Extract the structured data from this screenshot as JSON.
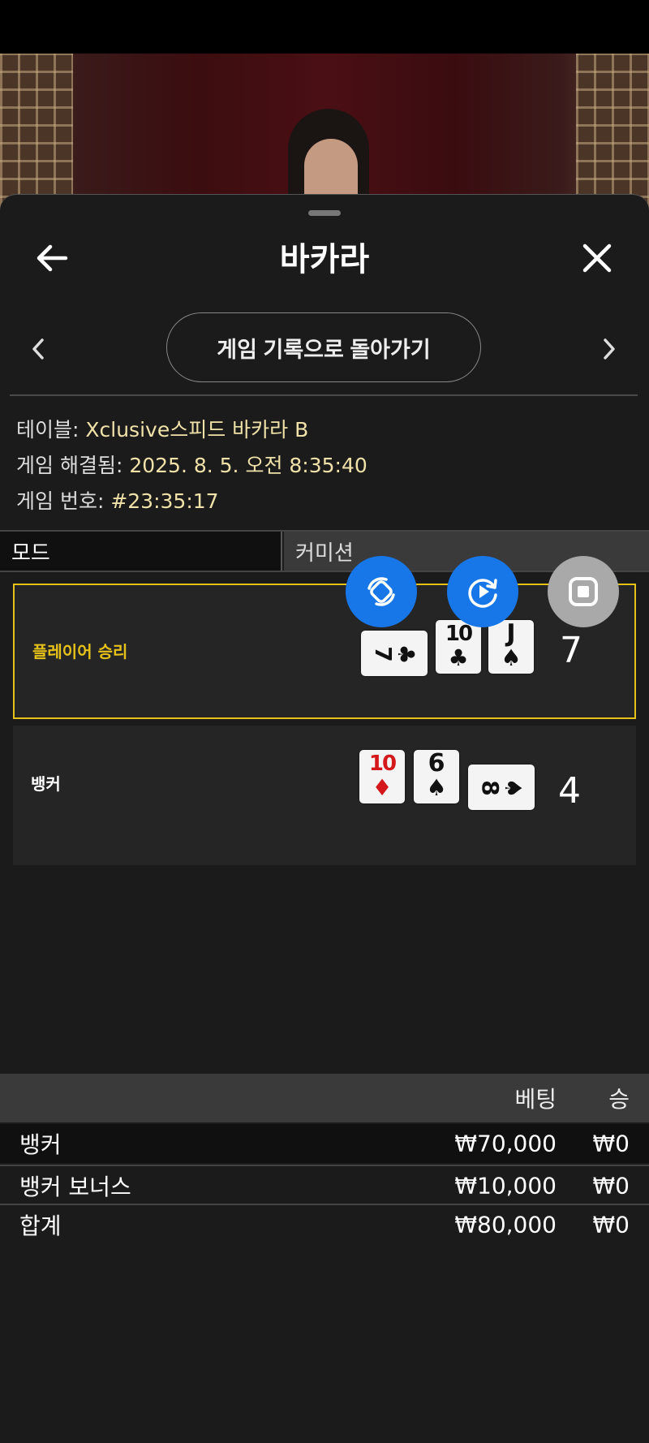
{
  "header": {
    "title": "바카라"
  },
  "nav": {
    "history_button": "게임 기록으로 돌아가기"
  },
  "info": {
    "table_label": "테이블:",
    "table_value": "Xclusive스피드 바카라 B",
    "resolved_label": "게임 해결됨:",
    "resolved_value": "2025. 8. 5. 오전 8:35:40",
    "number_label": "게임 번호:",
    "number_value": "#23:35:17"
  },
  "mode": {
    "mode_label": "모드",
    "mode_value": "커미션"
  },
  "results": {
    "player": {
      "label": "플레이어 승리",
      "score": "7",
      "label_color": "#e6c119",
      "cards": [
        {
          "rank": "7",
          "suit": "♣",
          "orientation": "sideways"
        },
        {
          "rank": "10",
          "suit": "♣"
        },
        {
          "rank": "J",
          "suit": "♠"
        }
      ]
    },
    "banker": {
      "label": "뱅커",
      "score": "4",
      "cards": [
        {
          "rank": "10",
          "suit": "♦",
          "color": "red"
        },
        {
          "rank": "6",
          "suit": "♠"
        },
        {
          "rank": "8",
          "suit": "♠",
          "orientation": "sideways"
        }
      ]
    }
  },
  "floating_controls": [
    "rotate-icon",
    "replay-icon",
    "stop-icon"
  ],
  "bets": {
    "headers": {
      "bet": "베팅",
      "win": "승"
    },
    "rows": [
      {
        "name": "뱅커",
        "bet": "₩70,000",
        "win": "₩0"
      },
      {
        "name": "뱅커 보너스",
        "bet": "₩10,000",
        "win": "₩0"
      },
      {
        "name": "합계",
        "bet": "₩80,000",
        "win": "₩0"
      }
    ]
  },
  "colors": {
    "accent_blue": "#1777e8",
    "winner_border": "#e6c119",
    "info_value": "#f0e2a8"
  }
}
